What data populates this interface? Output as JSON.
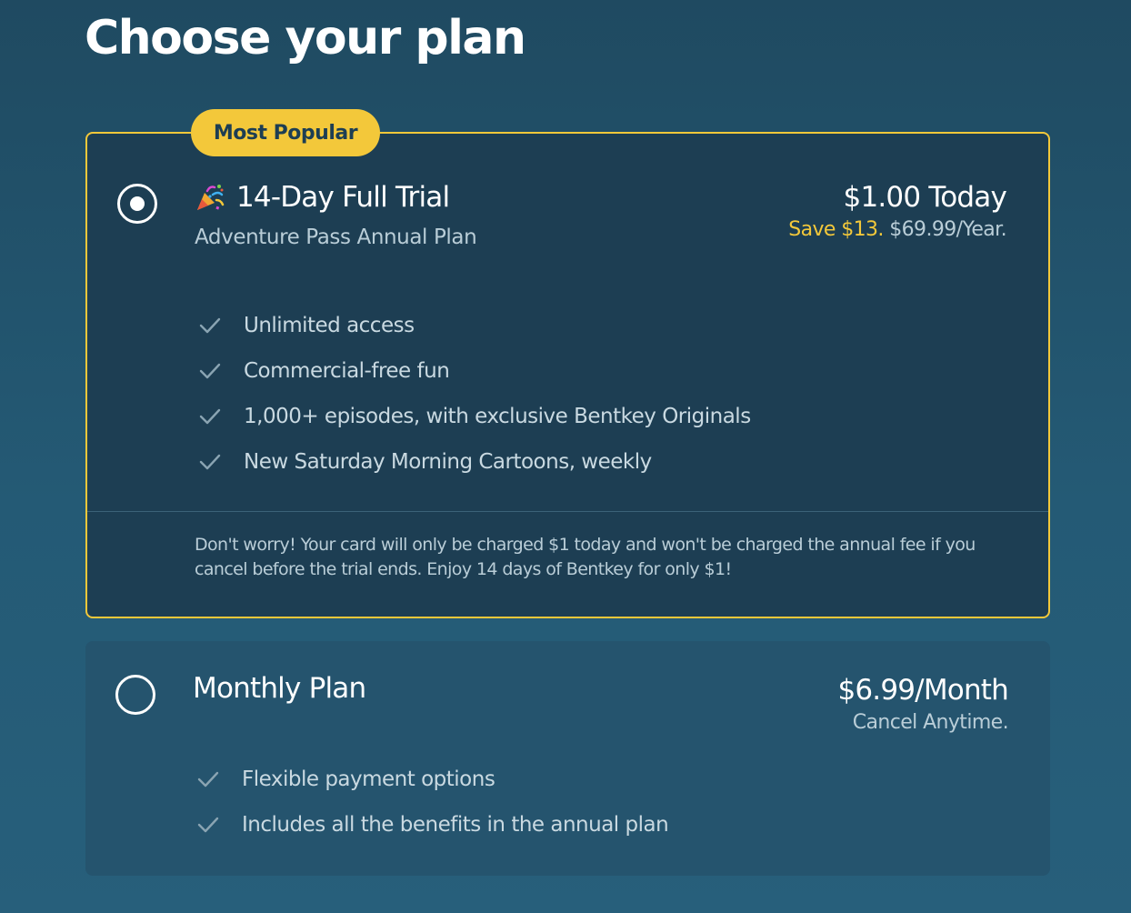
{
  "page": {
    "title": "Choose your plan"
  },
  "annual_plan": {
    "badge": "Most Popular",
    "selected": true,
    "title": "14-Day Full Trial",
    "title_icon": "party-popper-icon",
    "subtitle": "Adventure Pass Annual Plan",
    "price": "$1.00 Today",
    "save": "Save $13.",
    "price_note": "$69.99/Year.",
    "features": [
      "Unlimited access",
      "Commercial-free fun",
      "1,000+ episodes, with exclusive Bentkey Originals",
      "New Saturday Morning Cartoons, weekly"
    ],
    "note": "Don't worry! Your card will only be charged $1 today and won't be charged the annual fee if you cancel before the trial ends. Enjoy 14 days of Bentkey for only $1!"
  },
  "monthly_plan": {
    "selected": false,
    "title": "Monthly Plan",
    "price": "$6.99/Month",
    "price_note": "Cancel Anytime.",
    "features": [
      "Flexible payment options",
      "Includes all the benefits in the annual plan"
    ]
  },
  "colors": {
    "accent": "#f3c83a",
    "card_selected_bg": "#1d3e53",
    "card_bg": "#25546e",
    "text_muted": "#b9cdd7"
  },
  "icons": {
    "check": "check-icon",
    "radio_selected": "radio-selected-icon",
    "radio_unselected": "radio-unselected-icon"
  }
}
